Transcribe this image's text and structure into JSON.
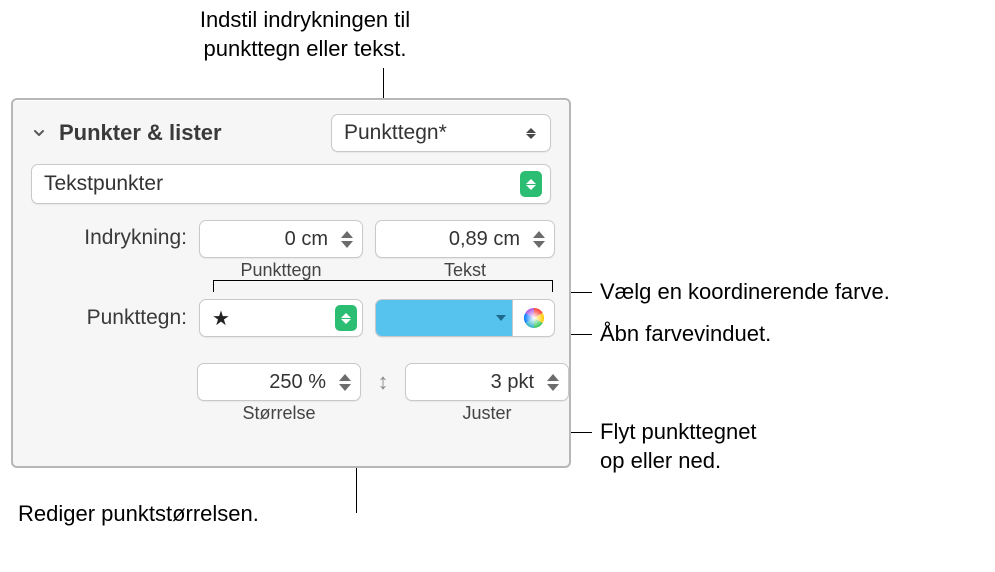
{
  "callouts": {
    "top": "Indstil indrykningen til\npunkttegn eller tekst.",
    "right1": "Vælg en koordinerende farve.",
    "right2": "Åbn farvevinduet.",
    "right3": "Flyt punkttegnet\nop eller ned.",
    "bottom": "Rediger punktstørrelsen."
  },
  "panel": {
    "section_title": "Punkter & lister",
    "style_popup": "Punkttegn*",
    "type_popup": "Tekstpunkter",
    "indent": {
      "label": "Indrykning:",
      "bullet_value": "0 cm",
      "bullet_caption": "Punkttegn",
      "text_value": "0,89 cm",
      "text_caption": "Tekst"
    },
    "bullet": {
      "label": "Punkttegn:",
      "glyph": "★"
    },
    "size": {
      "value": "250 %",
      "caption": "Størrelse"
    },
    "align": {
      "value": "3 pkt",
      "caption": "Juster"
    },
    "colors": {
      "swatch": "#56c3ef"
    }
  }
}
